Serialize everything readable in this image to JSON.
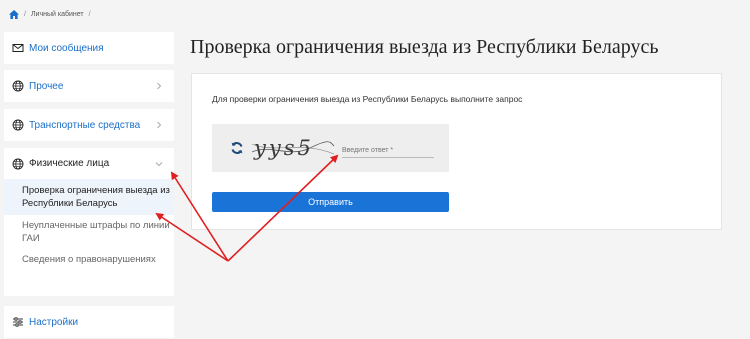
{
  "breadcrumb": {
    "items": [
      "Личный кабинет"
    ]
  },
  "sidebar": {
    "messages_label": "Мои сообщения",
    "other_label": "Прочее",
    "vehicles_label": "Транспортные средства",
    "individuals_label": "Физические лица",
    "sub_items": [
      "Проверка ограничения выезда из Республики Беларусь",
      "Неуплаченные штрафы по линии ГАИ",
      "Сведения о правонарушениях"
    ],
    "settings_label": "Настройки"
  },
  "main": {
    "title": "Проверка ограничения выезда из Республики Беларусь",
    "instruction": "Для проверки ограничения выезда из Республики Беларусь выполните запрос",
    "captcha": {
      "text": "yys5",
      "placeholder": "Введите ответ *"
    },
    "submit_label": "Отправить"
  },
  "colors": {
    "accent": "#1a73d6",
    "link": "#1a6fc9",
    "annotation": "#e02020"
  }
}
